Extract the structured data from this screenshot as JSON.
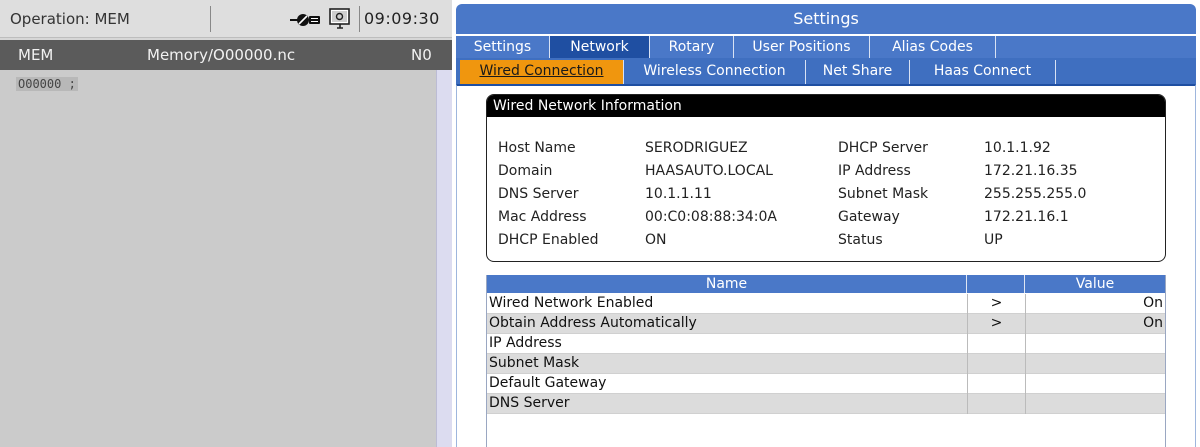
{
  "status_bar": {
    "operation": "Operation: MEM",
    "clock": "09:09:30",
    "icons": [
      "network-disconnected-icon",
      "screen-capture-icon"
    ]
  },
  "program": {
    "mode": "MEM",
    "file": "Memory/O00000.nc",
    "n_label": "N0",
    "code_line": "O00000 ;"
  },
  "settings": {
    "title": "Settings",
    "top_tabs": [
      "Settings",
      "Network",
      "Rotary",
      "User Positions",
      "Alias Codes"
    ],
    "active_top_tab": "Network",
    "sub_tabs": [
      "Wired Connection",
      "Wireless Connection",
      "Net Share",
      "Haas Connect"
    ],
    "active_sub_tab": "Wired Connection",
    "info": {
      "title": "Wired Network Information",
      "left": [
        {
          "label": "Host Name",
          "value": "SERODRIGUEZ"
        },
        {
          "label": "Domain",
          "value": "HAASAUTO.LOCAL"
        },
        {
          "label": "DNS Server",
          "value": "10.1.1.11"
        },
        {
          "label": "Mac Address",
          "value": "00:C0:08:88:34:0A"
        },
        {
          "label": "DHCP Enabled",
          "value": "ON"
        }
      ],
      "right": [
        {
          "label": "DHCP Server",
          "value": "10.1.1.92"
        },
        {
          "label": "IP Address",
          "value": "172.21.16.35"
        },
        {
          "label": "Subnet Mask",
          "value": "255.255.255.0"
        },
        {
          "label": "Gateway",
          "value": "172.21.16.1"
        },
        {
          "label": "Status",
          "value": "UP"
        }
      ]
    },
    "table": {
      "headers": {
        "name": "Name",
        "arrow": "",
        "value": "Value"
      },
      "rows": [
        {
          "name": "Wired Network Enabled",
          "arrow": ">",
          "value": "On"
        },
        {
          "name": "Obtain Address Automatically",
          "arrow": ">",
          "value": "On"
        },
        {
          "name": "IP Address",
          "arrow": "",
          "value": ""
        },
        {
          "name": "Subnet Mask",
          "arrow": "",
          "value": ""
        },
        {
          "name": "Default Gateway",
          "arrow": "",
          "value": ""
        },
        {
          "name": "DNS Server",
          "arrow": "",
          "value": ""
        }
      ]
    }
  },
  "colors": {
    "title_blue": "#4a78c8",
    "active_tab_blue": "#1f4fa2",
    "active_subtab_orange": "#f0960e",
    "program_header_gray": "#5b5b5b"
  }
}
